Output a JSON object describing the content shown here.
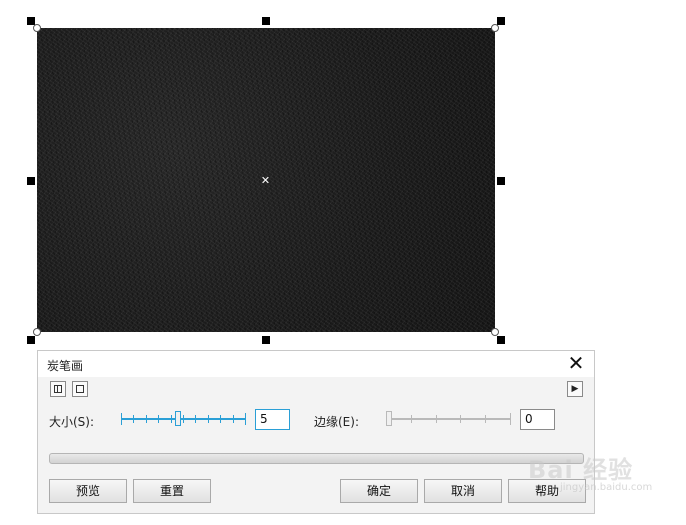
{
  "dialog": {
    "title": "炭笔画",
    "close_label": "✕",
    "expand_label": "▶",
    "size_label": "大小(S):",
    "size_value": "5",
    "size_slider_fraction": 0.45,
    "edge_label": "边缘(E):",
    "edge_value": "0",
    "edge_slider_fraction": 0.0,
    "buttons": {
      "preview": "预览",
      "reset": "重置",
      "ok": "确定",
      "cancel": "取消",
      "help": "帮助"
    }
  },
  "watermark": {
    "text": "Bai 经验",
    "sub": "jingyan.baidu.com"
  },
  "colors": {
    "accent_slider": "#2a9fd6",
    "disabled_slider": "#b9b9b9",
    "canvas": "#1b1b1b"
  },
  "icons": {
    "split_view": "split-view-icon",
    "single_view": "single-view-icon",
    "expand": "triangle-right-icon",
    "close": "close-icon",
    "center": "center-cross-icon"
  }
}
